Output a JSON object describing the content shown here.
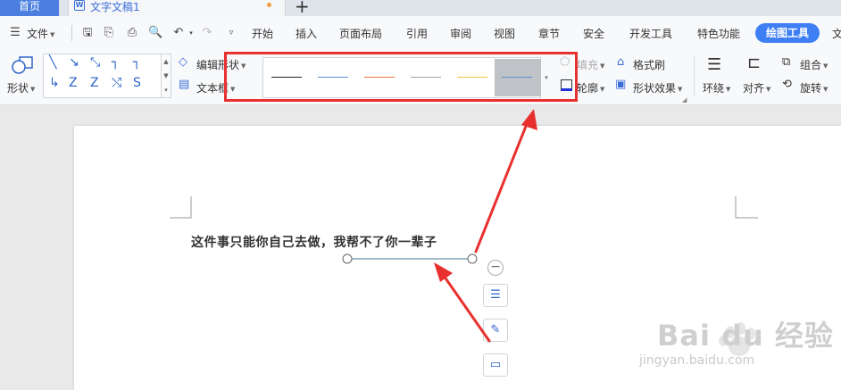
{
  "tabs": {
    "home_label": "首页",
    "doc_icon": "W",
    "doc_name": "文字文稿1",
    "new_tab": "+"
  },
  "menu": {
    "file_label": "文件",
    "items": [
      "开始",
      "插入",
      "页面布局",
      "引用",
      "审阅",
      "视图",
      "章节",
      "安全",
      "开发工具",
      "特色功能"
    ],
    "active": "绘图工具",
    "overflow": "文"
  },
  "ribbon": {
    "shape_label": "形状",
    "edit_shape": "编辑形状",
    "text_box": "文本框",
    "fill": "填充",
    "format_brush": "格式刷",
    "outline": "轮廓",
    "shape_effect": "形状效果",
    "wrap": "环绕",
    "align": "对齐",
    "group": "组合",
    "rotate": "旋转",
    "line_styles": [
      {
        "color": "#222222",
        "selected": false
      },
      {
        "color": "#5b8fd6",
        "selected": false
      },
      {
        "color": "#e07a3a",
        "selected": false
      },
      {
        "color": "#9aa3ad",
        "selected": false
      },
      {
        "color": "#f2c430",
        "selected": false
      },
      {
        "color": "#5b8fd6",
        "selected": true
      }
    ]
  },
  "document": {
    "text": "这件事只能你自己去做，我帮不了你一辈子",
    "shape_line_color": "#3b7a8f"
  },
  "watermark": {
    "brand": "Bai du 经验",
    "url": "jingyan.baidu.com"
  },
  "colors": {
    "accent": "#3f7ff4",
    "highlight": "#e8302e"
  }
}
